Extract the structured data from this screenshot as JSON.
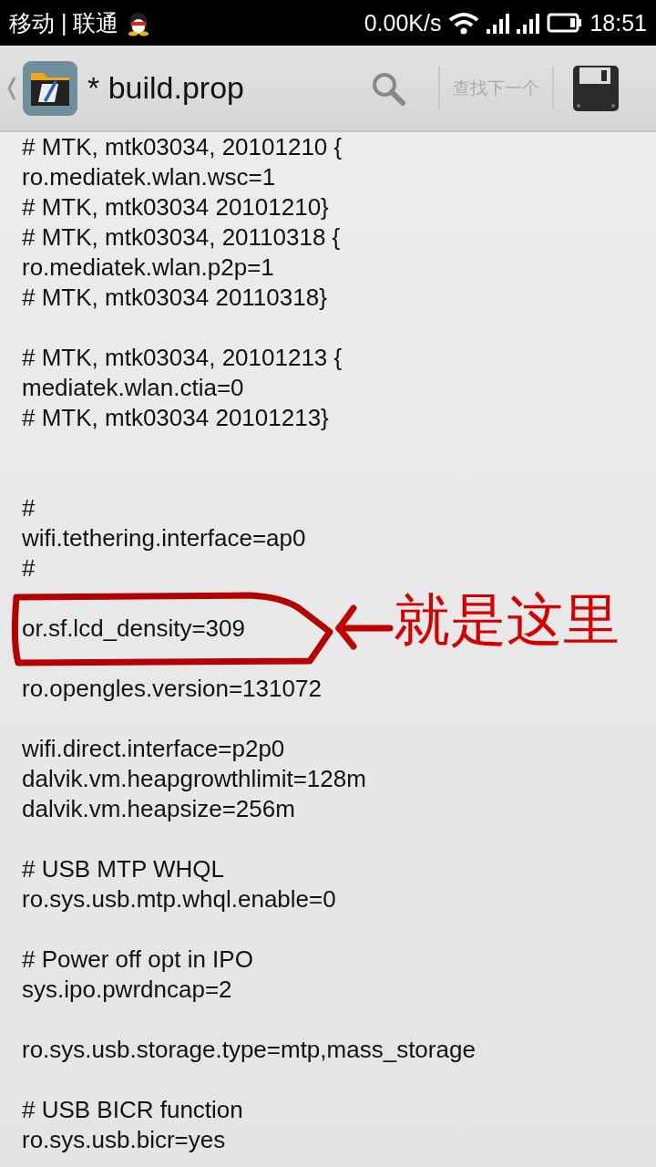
{
  "status_bar": {
    "carrier": "移动 | 联通",
    "speed": "0.00K/s",
    "time": "18:51"
  },
  "toolbar": {
    "title": "* build.prop",
    "find_next": "查找下一个"
  },
  "editor": {
    "lines": [
      {
        "kind": "code",
        "text": "# MTK, mtk03034, 20101210 {",
        "circled": false
      },
      {
        "kind": "code",
        "text": "ro.mediatek.wlan.wsc=1",
        "circled": false
      },
      {
        "kind": "code",
        "text": "# MTK, mtk03034 20101210}",
        "circled": false
      },
      {
        "kind": "code",
        "text": "# MTK, mtk03034, 20110318 {",
        "circled": false
      },
      {
        "kind": "code",
        "text": "ro.mediatek.wlan.p2p=1",
        "circled": false
      },
      {
        "kind": "code",
        "text": "# MTK, mtk03034 20110318}",
        "circled": false
      },
      {
        "kind": "blank"
      },
      {
        "kind": "code",
        "text": "# MTK, mtk03034, 20101213 {",
        "circled": false
      },
      {
        "kind": "code",
        "text": "mediatek.wlan.ctia=0",
        "circled": false
      },
      {
        "kind": "code",
        "text": "# MTK, mtk03034 20101213}",
        "circled": false
      },
      {
        "kind": "blank"
      },
      {
        "kind": "blank"
      },
      {
        "kind": "code",
        "text": "#",
        "circled": false
      },
      {
        "kind": "code",
        "text": "wifi.tethering.interface=ap0",
        "circled": false
      },
      {
        "kind": "code",
        "text": "#",
        "circled": false
      },
      {
        "kind": "blank"
      },
      {
        "kind": "code",
        "text": "or.sf.lcd_density=309",
        "circled": true
      },
      {
        "kind": "blank"
      },
      {
        "kind": "code",
        "text": "ro.opengles.version=131072",
        "circled": false
      },
      {
        "kind": "blank"
      },
      {
        "kind": "code",
        "text": "wifi.direct.interface=p2p0",
        "circled": false
      },
      {
        "kind": "code",
        "text": "dalvik.vm.heapgrowthlimit=128m",
        "circled": false
      },
      {
        "kind": "code",
        "text": "dalvik.vm.heapsize=256m",
        "circled": false
      },
      {
        "kind": "blank"
      },
      {
        "kind": "code",
        "text": "# USB MTP WHQL",
        "circled": false
      },
      {
        "kind": "code",
        "text": "ro.sys.usb.mtp.whql.enable=0",
        "circled": false
      },
      {
        "kind": "blank"
      },
      {
        "kind": "code",
        "text": "# Power off opt in IPO",
        "circled": false
      },
      {
        "kind": "code",
        "text": "sys.ipo.pwrdncap=2",
        "circled": false
      },
      {
        "kind": "blank"
      },
      {
        "kind": "code",
        "text": "ro.sys.usb.storage.type=mtp,mass_storage",
        "circled": false
      },
      {
        "kind": "blank"
      },
      {
        "kind": "code",
        "text": "# USB BICR function",
        "circled": false
      },
      {
        "kind": "code",
        "text": "ro.sys.usb.bicr=yes",
        "circled": false
      }
    ]
  },
  "annotation": {
    "text": "就是这里"
  }
}
